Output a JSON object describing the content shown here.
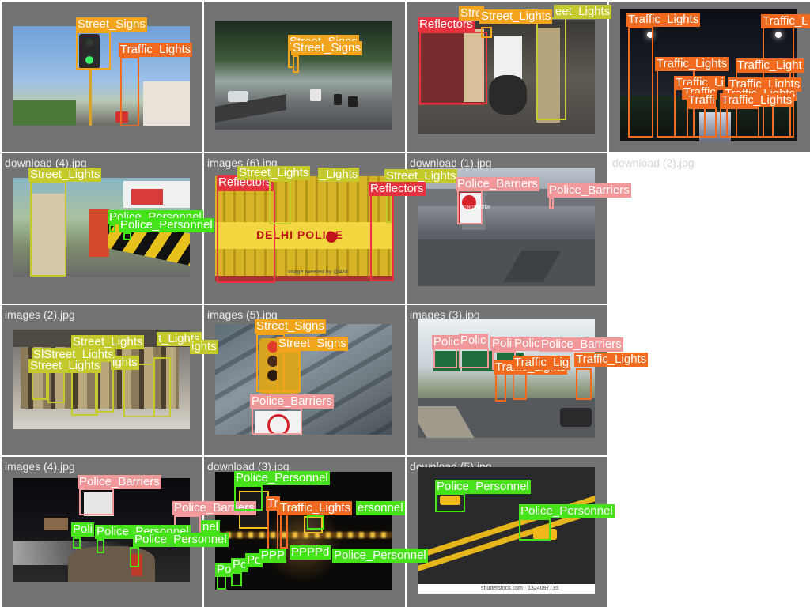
{
  "class_names": [
    "Street_Signs",
    "Traffic_Lights",
    "Street_Lights",
    "Reflectors",
    "Police_Barriers",
    "Police_Personnel"
  ],
  "class_colors": {
    "Street_Signs": "#f2a51c",
    "Traffic_Lights": "#f06a1f",
    "Street_Lights": "#c4c92c",
    "Reflectors": "#e8323f",
    "Police_Barriers": "#f0989a",
    "Police_Personnel": "#47e31a"
  },
  "tiles": [
    {
      "filename": "",
      "scene": "Traffic signal on a pole under clear sky"
    },
    {
      "filename": "",
      "scene": "Tree-lined road with motorbikes"
    },
    {
      "filename": "",
      "scene": "Police officers with motorbike at night checkpoint"
    },
    {
      "filename": "",
      "scene": "Street lights along a road at night"
    },
    {
      "filename": "download (4).jpg",
      "scene": "Officer beside striped road divider"
    },
    {
      "filename": "images (6).jpg",
      "scene": "Yellow Delhi Police barricade"
    },
    {
      "filename": "download (1).jpg",
      "scene": "Overpass with do not enter sign"
    },
    {
      "filename": "download (2).jpg",
      "scene": ""
    },
    {
      "filename": "images (2).jpg",
      "scene": "Police personnel marching on street"
    },
    {
      "filename": "images (5).jpg",
      "scene": "Traffic light and no-turn sign"
    },
    {
      "filename": "images (3).jpg",
      "scene": "Highway with signboards and traffic lights"
    },
    {
      "filename": "",
      "scene": ""
    },
    {
      "filename": "images (4).jpg",
      "scene": "Roadside at night with barrier sign"
    },
    {
      "filename": "download (3).jpg",
      "scene": "Night road with illuminated chevrons"
    },
    {
      "filename": "download (5).jpg",
      "scene": "Road reflectors on asphalt"
    },
    {
      "filename": "",
      "scene": ""
    }
  ],
  "photo_text": {
    "delhi_police": "DELHI POLICE",
    "do_not_enter": "DO NOT ENTER",
    "watermark_shutterstock": "shutterstock.com · 1324097735",
    "watermark_image": "Image tweeted by @ANI"
  },
  "detections": [
    {
      "cls": "Street_Signs",
      "label": "Street_Signs",
      "tile": 0
    },
    {
      "cls": "Traffic_Lights",
      "label": "Traffic_Lights",
      "tile": 0
    },
    {
      "cls": "Street_Signs",
      "label": "Street_Signs",
      "tile": 1
    },
    {
      "cls": "Street_Signs",
      "label": "Street_Signs",
      "tile": 1
    },
    {
      "cls": "Reflectors",
      "label": "Reflectors",
      "tile": 2
    },
    {
      "cls": "Street_Signs",
      "label": "Stre",
      "tile": 2
    },
    {
      "cls": "Street_Signs",
      "label": "Street_Lights",
      "tile": 2
    },
    {
      "cls": "Street_Lights",
      "label": "eet_Lights",
      "tile": 2
    },
    {
      "cls": "Traffic_Lights",
      "label": "Traffic_Lights",
      "tile": 3
    },
    {
      "cls": "Traffic_Lights",
      "label": "Traffic_L",
      "tile": 3
    },
    {
      "cls": "Traffic_Lights",
      "label": "Traffic_Lights",
      "tile": 3
    },
    {
      "cls": "Traffic_Lights",
      "label": "Traffic_Light",
      "tile": 3
    },
    {
      "cls": "Traffic_Lights",
      "label": "Traffic_Li",
      "tile": 3
    },
    {
      "cls": "Traffic_Lights",
      "label": "Traffic_Lights",
      "tile": 3
    },
    {
      "cls": "Traffic_Lights",
      "label": "Traffic",
      "tile": 3
    },
    {
      "cls": "Traffic_Lights",
      "label": "Traffic_Lights",
      "tile": 3
    },
    {
      "cls": "Traffic_Lights",
      "label": "Traffi",
      "tile": 3
    },
    {
      "cls": "Traffic_Lights",
      "label": "Traffic_Lights",
      "tile": 3
    },
    {
      "cls": "Street_Lights",
      "label": "Street_Lights",
      "tile": 4
    },
    {
      "cls": "Police_Personnel",
      "label": "Police_Personnel",
      "tile": 4
    },
    {
      "cls": "Police_Personnel",
      "label": "Police_Personnel",
      "tile": 4
    },
    {
      "cls": "Reflectors",
      "label": "Reflectors",
      "tile": 5
    },
    {
      "cls": "Street_Lights",
      "label": "Street_Lights",
      "tile": 5
    },
    {
      "cls": "Street_Lights",
      "label": "_Lights",
      "tile": 5
    },
    {
      "cls": "Street_Lights",
      "label": "Street_Lights",
      "tile": 5
    },
    {
      "cls": "Reflectors",
      "label": "Reflectors",
      "tile": 5
    },
    {
      "cls": "Police_Barriers",
      "label": "Police_Barriers",
      "tile": 6
    },
    {
      "cls": "Police_Barriers",
      "label": "Police_Barriers",
      "tile": 6
    },
    {
      "cls": "Street_Lights",
      "label": "Street_Lights",
      "tile": 8
    },
    {
      "cls": "Street_Lights",
      "label": "t_Lights",
      "tile": 8
    },
    {
      "cls": "Street_Lights",
      "label": "ights",
      "tile": 8
    },
    {
      "cls": "Street_Lights",
      "label": "SlStreet_Lights",
      "tile": 8
    },
    {
      "cls": "Street_Lights",
      "label": "Street_Lights",
      "tile": 8
    },
    {
      "cls": "Street_Lights",
      "label": "ights",
      "tile": 8
    },
    {
      "cls": "Street_Signs",
      "label": "Street_Signs",
      "tile": 9
    },
    {
      "cls": "Street_Signs",
      "label": "Street_Signs",
      "tile": 9
    },
    {
      "cls": "Police_Barriers",
      "label": "Police_Barriers",
      "tile": 9
    },
    {
      "cls": "Police_Barriers",
      "label": "Polic",
      "tile": 10
    },
    {
      "cls": "Police_Barriers",
      "label": "Polic",
      "tile": 10
    },
    {
      "cls": "Police_Barriers",
      "label": "Poli",
      "tile": 10
    },
    {
      "cls": "Police_Barriers",
      "label": "Polic",
      "tile": 10
    },
    {
      "cls": "Police_Barriers",
      "label": "Police_Barriers",
      "tile": 10
    },
    {
      "cls": "Traffic_Lights",
      "label": "Traffic_Lights",
      "tile": 10
    },
    {
      "cls": "Traffic_Lights",
      "label": "Traffic_Lig",
      "tile": 10
    },
    {
      "cls": "Traffic_Lights",
      "label": "Traffic_Lights",
      "tile": 10
    },
    {
      "cls": "Police_Barriers",
      "label": "Police_Barriers",
      "tile": 12
    },
    {
      "cls": "Police_Barriers",
      "label": "Police_Barriers",
      "tile": 12
    },
    {
      "cls": "Police_Personnel",
      "label": "Poli",
      "tile": 12
    },
    {
      "cls": "Police_Personnel",
      "label": "Police_Personnel",
      "tile": 12
    },
    {
      "cls": "Police_Personnel",
      "label": "nel",
      "tile": 12
    },
    {
      "cls": "Police_Personnel",
      "label": "Police_Personnel",
      "tile": 12
    },
    {
      "cls": "Police_Personnel",
      "label": "Police_Personnel",
      "tile": 13
    },
    {
      "cls": "Traffic_Lights",
      "label": "Tr",
      "tile": 13
    },
    {
      "cls": "Traffic_Lights",
      "label": "Traffic_Lights",
      "tile": 13
    },
    {
      "cls": "Police_Personnel",
      "label": "ersonnel",
      "tile": 13
    },
    {
      "cls": "Police_Personnel",
      "label": "Po",
      "tile": 13
    },
    {
      "cls": "Police_Personnel",
      "label": "Po",
      "tile": 13
    },
    {
      "cls": "Police_Personnel",
      "label": "Pd",
      "tile": 13
    },
    {
      "cls": "Police_Personnel",
      "label": "PPP",
      "tile": 13
    },
    {
      "cls": "Police_Personnel",
      "label": "PPPPd",
      "tile": 13
    },
    {
      "cls": "Police_Personnel",
      "label": "Police_Personnel",
      "tile": 13
    },
    {
      "cls": "Police_Personnel",
      "label": "Police_Personnel",
      "tile": 14
    },
    {
      "cls": "Police_Personnel",
      "label": "Police_Personnel",
      "tile": 14
    }
  ]
}
